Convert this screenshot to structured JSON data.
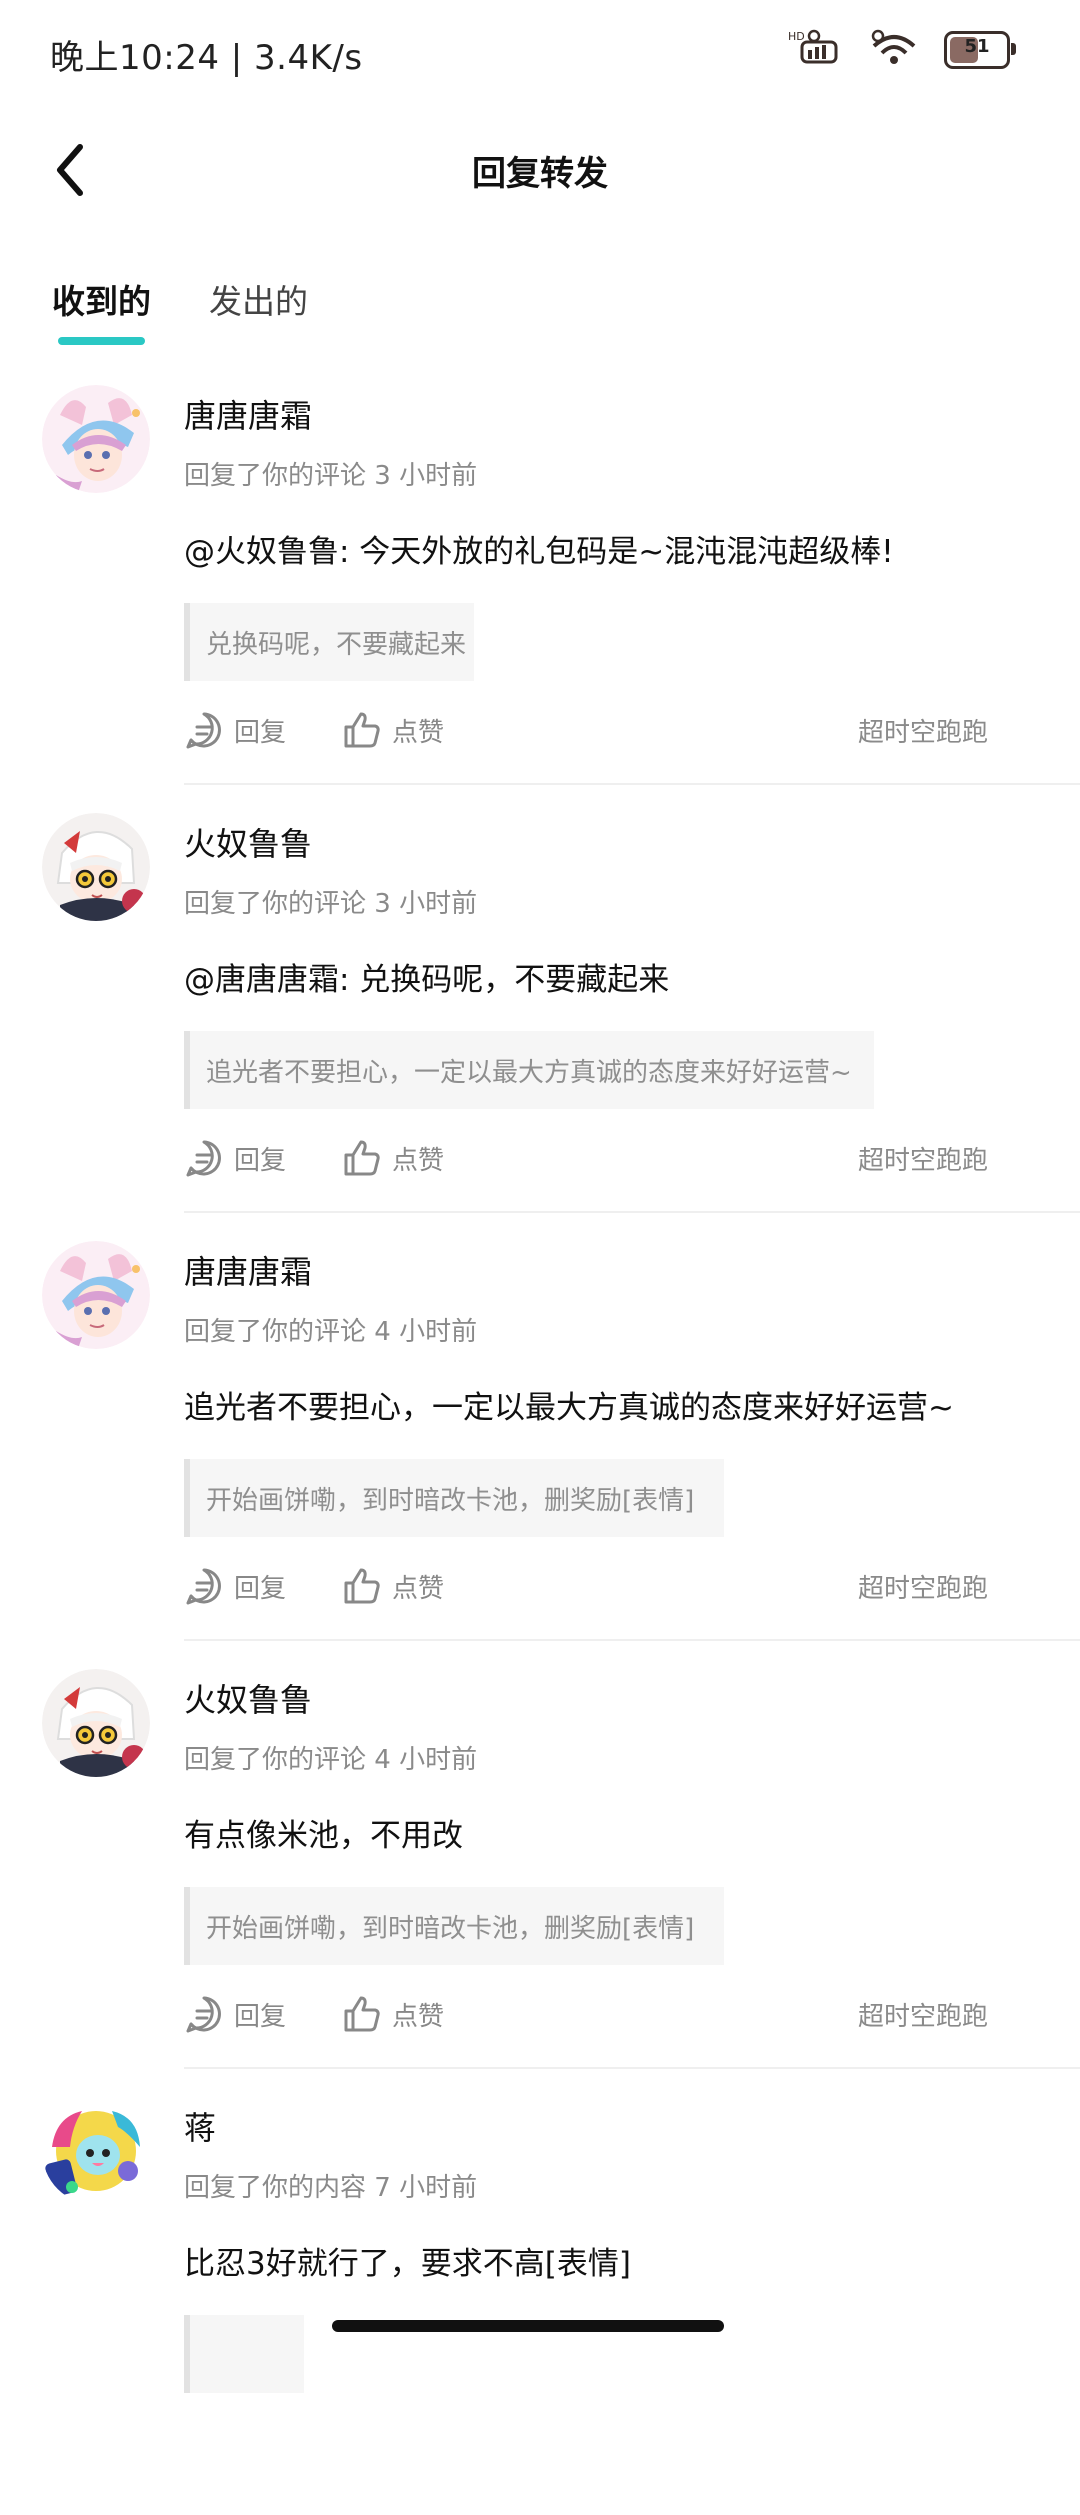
{
  "status": {
    "time_speed": "晚上10:24 | 3.4K/s",
    "battery": "51",
    "battery_level": 0.51
  },
  "header": {
    "title": "回复转发"
  },
  "tabs": [
    {
      "label": "收到的",
      "active": true
    },
    {
      "label": "发出的",
      "active": false
    }
  ],
  "comments": [
    {
      "username": "唐唐唐霜",
      "meta": "回复了你的评论 3 小时前",
      "text": "@火奴鲁鲁: 今天外放的礼包码是~混沌混沌超级棒!",
      "quote": "兑换码呢，不要藏起来",
      "reply_label": "回复",
      "like_label": "点赞",
      "author": "超时空跑跑",
      "avatar": "avatar-pink-girl"
    },
    {
      "username": "火奴鲁鲁",
      "meta": "回复了你的评论 3 小时前",
      "text": "@唐唐唐霜: 兑换码呢，不要藏起来",
      "quote": "追光者不要担心，一定以最大方真诚的态度来好好运营~",
      "reply_label": "回复",
      "like_label": "点赞",
      "author": "超时空跑跑",
      "avatar": "avatar-white-hair"
    },
    {
      "username": "唐唐唐霜",
      "meta": "回复了你的评论 4 小时前",
      "text": "追光者不要担心，一定以最大方真诚的态度来好好运营~",
      "quote": "开始画饼嘞，到时暗改卡池，删奖励[表情]",
      "reply_label": "回复",
      "like_label": "点赞",
      "author": "超时空跑跑",
      "avatar": "avatar-pink-girl"
    },
    {
      "username": "火奴鲁鲁",
      "meta": "回复了你的评论 4 小时前",
      "text": "有点像米池，不用改",
      "quote": "开始画饼嘞，到时暗改卡池，删奖励[表情]",
      "reply_label": "回复",
      "like_label": "点赞",
      "author": "超时空跑跑",
      "avatar": "avatar-white-hair"
    },
    {
      "username": "蒋",
      "meta": "回复了你的内容 7 小时前",
      "text": "比忍3好就行了，要求不高[表情]",
      "avatar": "avatar-colorful"
    }
  ],
  "colors": {
    "accent": "#2ac8c4",
    "secondary_text": "#8a8a8a",
    "quote_bg": "#f6f6f6"
  }
}
